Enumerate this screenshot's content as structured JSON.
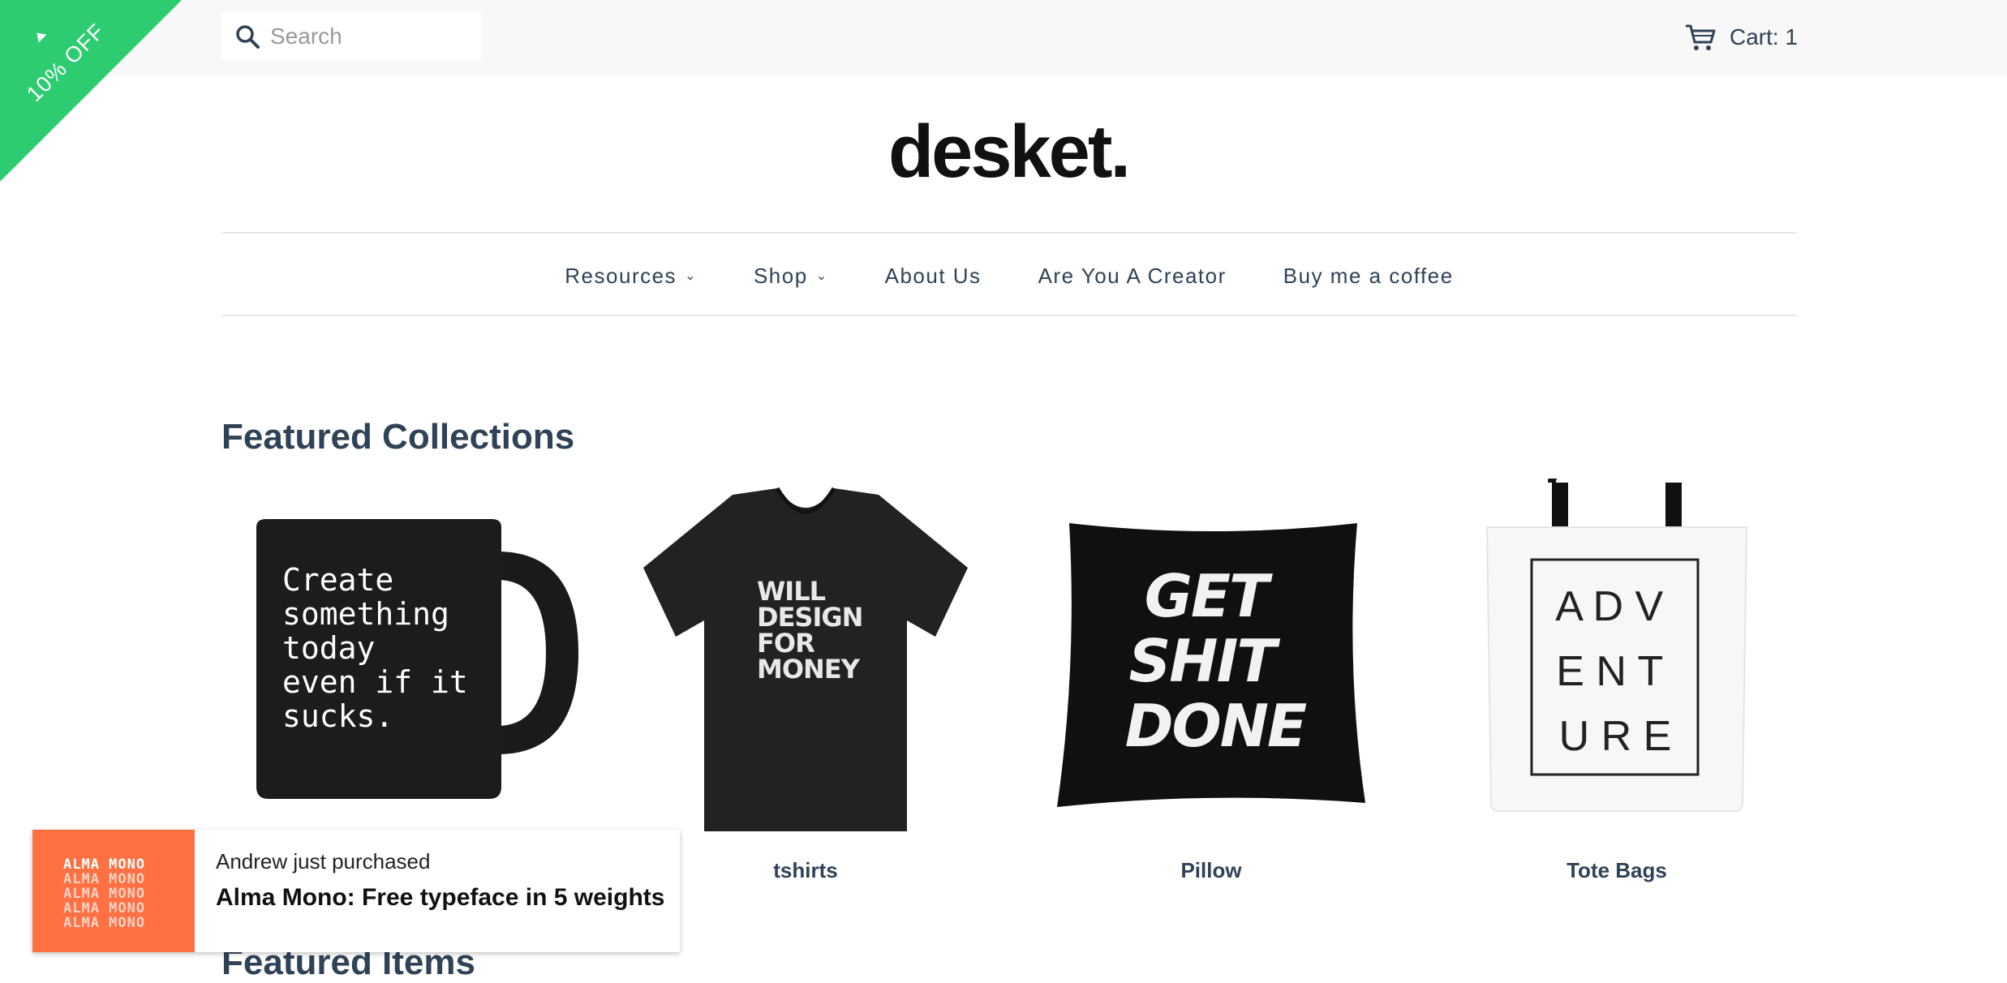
{
  "promo": {
    "ribbon_text": "10% OFF",
    "color": "#2ecc71"
  },
  "header": {
    "search_placeholder": "Search",
    "cart_label": "Cart: 1",
    "logo_text": "desket."
  },
  "nav": {
    "items": [
      {
        "label": "Resources",
        "has_dropdown": true
      },
      {
        "label": "Shop",
        "has_dropdown": true
      },
      {
        "label": "About Us",
        "has_dropdown": false
      },
      {
        "label": "Are You A Creator",
        "has_dropdown": false
      },
      {
        "label": "Buy me a coffee",
        "has_dropdown": false
      }
    ]
  },
  "featured_collections": {
    "title": "Featured Collections",
    "items": [
      {
        "label": "",
        "image_text": [
          "Create",
          "something",
          "today",
          "even if it",
          "sucks."
        ]
      },
      {
        "label": "tshirts",
        "image_text": [
          "WILL",
          "DESIGN",
          "FOR",
          "MONEY"
        ]
      },
      {
        "label": "Pillow",
        "image_text": [
          "GET",
          "SHIT",
          "DONE"
        ]
      },
      {
        "label": "Tote Bags",
        "image_text": [
          "A D V",
          "E N T",
          "U R E"
        ]
      }
    ]
  },
  "featured_items": {
    "title": "Featured Items"
  },
  "notification": {
    "subtitle": "Andrew just purchased",
    "title": "Alma Mono: Free typeface in 5 weights",
    "thumb_text": "ALMA MONO",
    "thumb_color": "#ff7043"
  }
}
